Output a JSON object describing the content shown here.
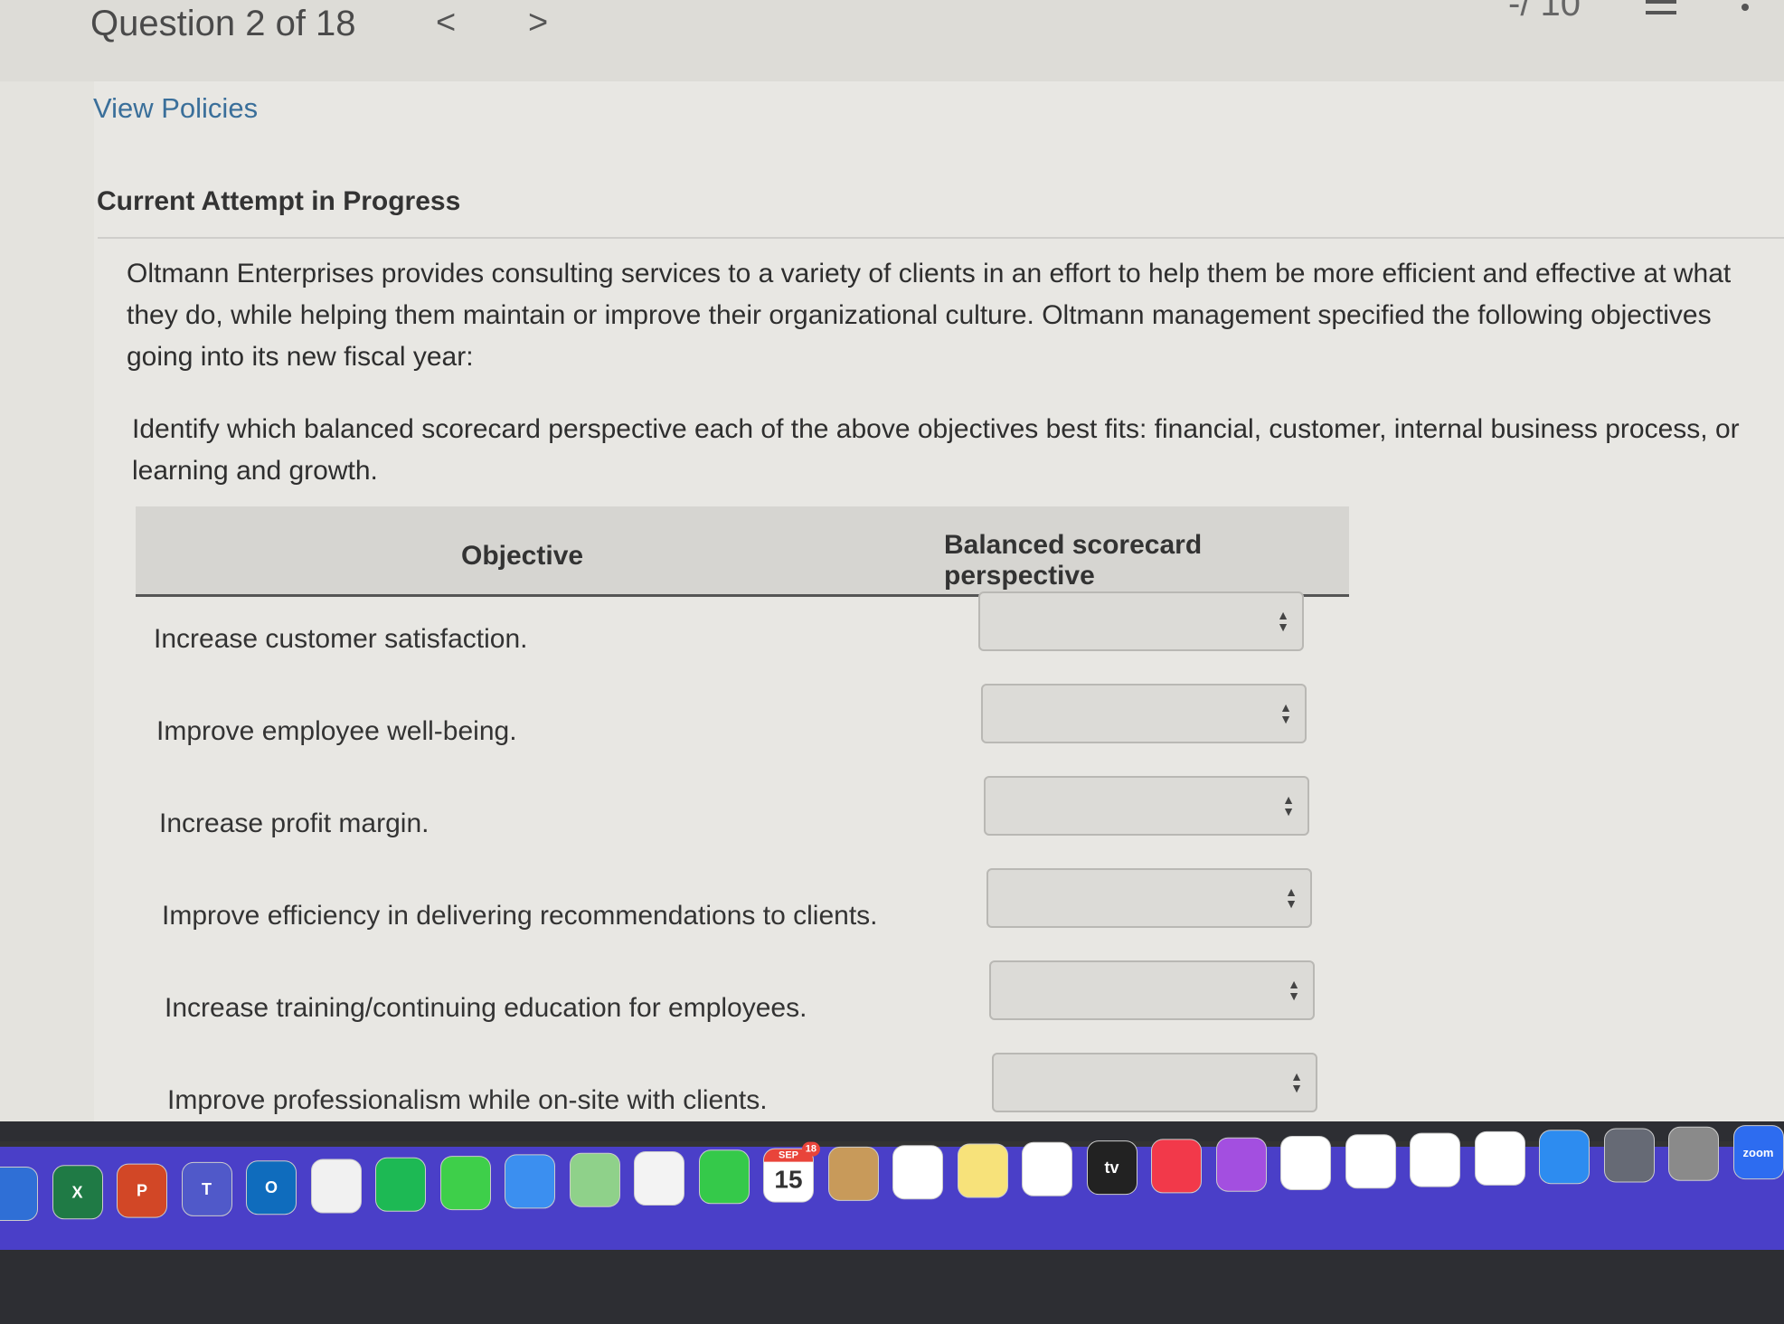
{
  "header": {
    "title": "Question 2 of 18",
    "prev": "<",
    "next": ">",
    "score": "-/ 10"
  },
  "links": {
    "view_policies": "View Policies"
  },
  "section_title": "Current Attempt in Progress",
  "question": {
    "intro": "Oltmann Enterprises provides consulting services to a variety of clients in an effort to help them be more efficient and effective at what they do, while helping them maintain or improve their organizational culture. Oltmann management specified the following objectives going into its new fiscal year:",
    "prompt": "Identify which balanced scorecard perspective each of the above objectives best fits: financial, customer, internal business process, or learning and growth."
  },
  "table": {
    "headers": [
      "Objective",
      "Balanced scorecard perspective"
    ],
    "rows": [
      {
        "objective": "Increase customer satisfaction.",
        "selected": ""
      },
      {
        "objective": "Improve employee well-being.",
        "selected": ""
      },
      {
        "objective": "Increase profit margin.",
        "selected": ""
      },
      {
        "objective": "Improve efficiency in delivering recommendations to clients.",
        "selected": ""
      },
      {
        "objective": "Increase training/continuing education for employees.",
        "selected": ""
      },
      {
        "objective": "Improve professionalism while on-site with clients.",
        "selected": ""
      }
    ]
  },
  "dock": {
    "calendar_month": "SEP",
    "calendar_day": "15",
    "calendar_badge": "18",
    "tv_label": "tv",
    "zoom_label": "zoom",
    "apps": [
      {
        "name": "finder",
        "color": "#2f6fd6"
      },
      {
        "name": "excel",
        "color": "#1f7a45",
        "label": "X"
      },
      {
        "name": "powerpoint",
        "color": "#d24726",
        "label": "P"
      },
      {
        "name": "teams",
        "color": "#5059c9",
        "label": "T"
      },
      {
        "name": "outlook",
        "color": "#0f6cbd",
        "label": "O"
      },
      {
        "name": "microsoft-store",
        "color": "#f1f1f1"
      },
      {
        "name": "spotify",
        "color": "#1db954"
      },
      {
        "name": "messages",
        "color": "#3ecf4a"
      },
      {
        "name": "mail",
        "color": "#3b8ff0"
      },
      {
        "name": "maps",
        "color": "#8fd18a"
      },
      {
        "name": "photos",
        "color": "#f3f3f3"
      },
      {
        "name": "facetime",
        "color": "#35c94a"
      },
      {
        "name": "calendar",
        "color": "#ffffff"
      },
      {
        "name": "contacts",
        "color": "#c89a5a"
      },
      {
        "name": "reminders",
        "color": "#ffffff"
      },
      {
        "name": "notes",
        "color": "#f7e27a"
      },
      {
        "name": "freeform",
        "color": "#ffffff"
      },
      {
        "name": "apple-tv",
        "color": "#222222"
      },
      {
        "name": "music",
        "color": "#f2394a"
      },
      {
        "name": "podcasts",
        "color": "#a34fe0"
      },
      {
        "name": "news",
        "color": "#ffffff"
      },
      {
        "name": "keynote",
        "color": "#ffffff"
      },
      {
        "name": "numbers",
        "color": "#ffffff"
      },
      {
        "name": "pages",
        "color": "#ffffff"
      },
      {
        "name": "app-store",
        "color": "#2d8cf0"
      },
      {
        "name": "screen-sharing",
        "color": "#666a75"
      },
      {
        "name": "system-settings",
        "color": "#8a8a8a"
      },
      {
        "name": "zoom",
        "color": "#2d6cf0"
      }
    ]
  }
}
